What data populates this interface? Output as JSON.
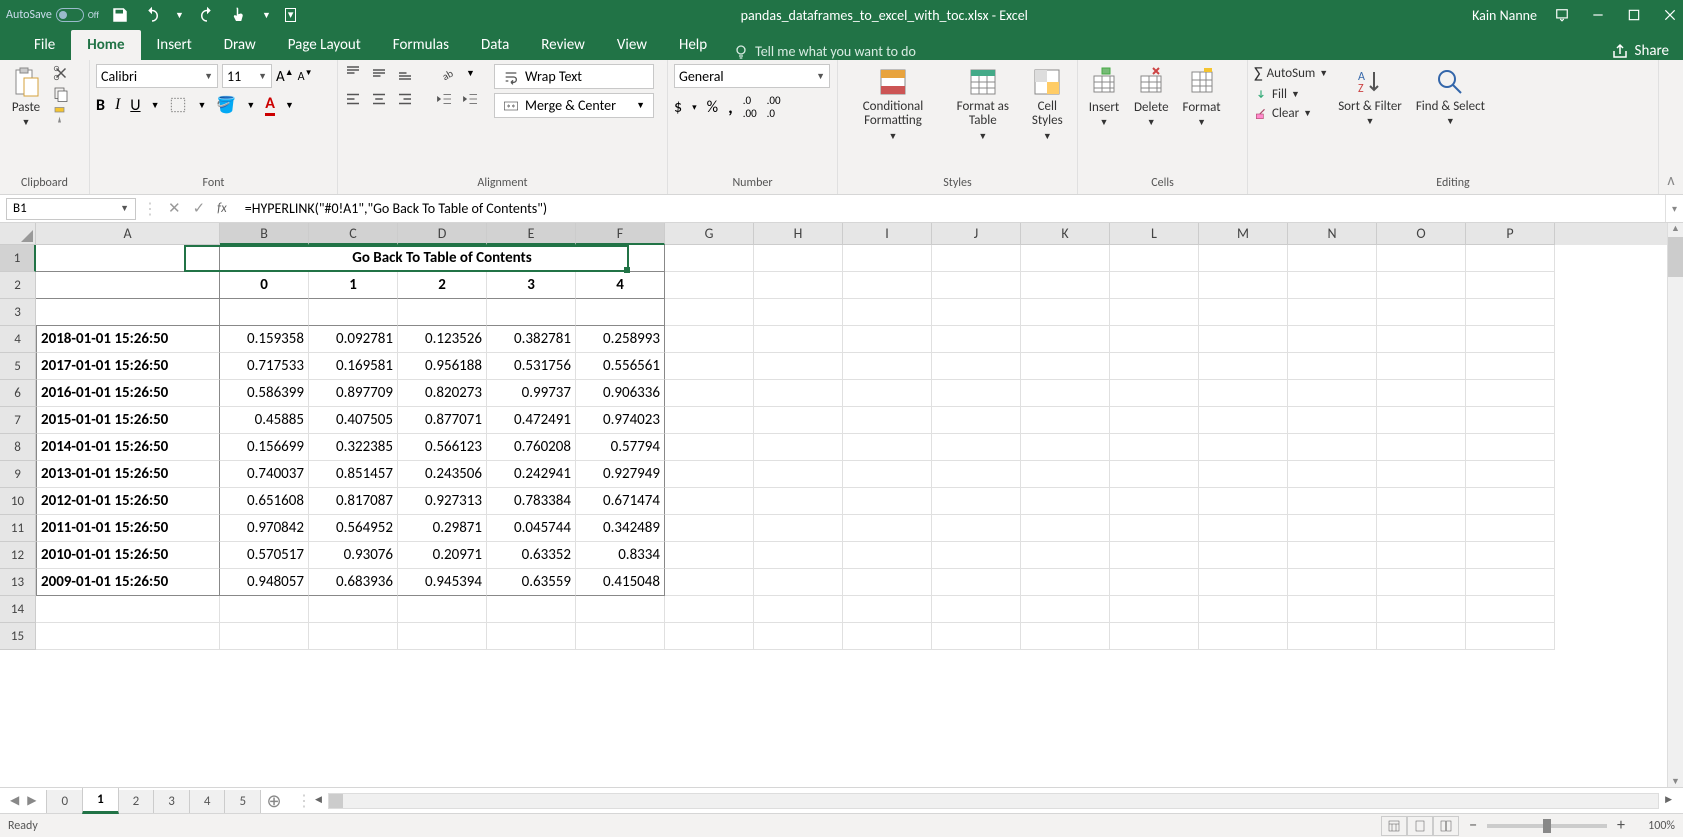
{
  "titlebar": {
    "autosave": "AutoSave",
    "autosave_state": "Off",
    "filename": "pandas_dataframes_to_excel_with_toc.xlsx - Excel",
    "user": "Kain Nanne"
  },
  "menu": {
    "tabs": [
      "File",
      "Home",
      "Insert",
      "Draw",
      "Page Layout",
      "Formulas",
      "Data",
      "Review",
      "View",
      "Help"
    ],
    "active": "Home",
    "tellme": "Tell me what you want to do",
    "share": "Share"
  },
  "ribbon": {
    "clipboard": {
      "label": "Clipboard",
      "paste": "Paste"
    },
    "font": {
      "label": "Font",
      "name": "Calibri",
      "size": "11"
    },
    "alignment": {
      "label": "Alignment",
      "wrap": "Wrap Text",
      "merge": "Merge & Center"
    },
    "number": {
      "label": "Number",
      "format": "General"
    },
    "styles": {
      "label": "Styles",
      "cond": "Conditional Formatting",
      "table": "Format as Table",
      "cell": "Cell Styles"
    },
    "cells": {
      "label": "Cells",
      "insert": "Insert",
      "delete": "Delete",
      "format": "Format"
    },
    "editing": {
      "label": "Editing",
      "autosum": "AutoSum",
      "fill": "Fill",
      "clear": "Clear",
      "sort": "Sort & Filter",
      "find": "Find & Select"
    }
  },
  "formula_bar": {
    "cell_ref": "B1",
    "formula": "=HYPERLINK(\"#0!A1\",\"Go Back To Table of Contents\")"
  },
  "grid": {
    "columns": [
      "A",
      "B",
      "C",
      "D",
      "E",
      "F",
      "G",
      "H",
      "I",
      "J",
      "K",
      "L",
      "M",
      "N",
      "O",
      "P"
    ],
    "selected_cols": [
      "B",
      "C",
      "D",
      "E",
      "F"
    ],
    "selected_row": 1,
    "row_count": 15,
    "merged_link": "Go Back To Table of Contents",
    "headers": [
      "0",
      "1",
      "2",
      "3",
      "4"
    ],
    "data": [
      {
        "ts": "2018-01-01 15:26:50",
        "v": [
          "0.159358",
          "0.092781",
          "0.123526",
          "0.382781",
          "0.258993"
        ]
      },
      {
        "ts": "2017-01-01 15:26:50",
        "v": [
          "0.717533",
          "0.169581",
          "0.956188",
          "0.531756",
          "0.556561"
        ]
      },
      {
        "ts": "2016-01-01 15:26:50",
        "v": [
          "0.586399",
          "0.897709",
          "0.820273",
          "0.99737",
          "0.906336"
        ]
      },
      {
        "ts": "2015-01-01 15:26:50",
        "v": [
          "0.45885",
          "0.407505",
          "0.877071",
          "0.472491",
          "0.974023"
        ]
      },
      {
        "ts": "2014-01-01 15:26:50",
        "v": [
          "0.156699",
          "0.322385",
          "0.566123",
          "0.760208",
          "0.57794"
        ]
      },
      {
        "ts": "2013-01-01 15:26:50",
        "v": [
          "0.740037",
          "0.851457",
          "0.243506",
          "0.242941",
          "0.927949"
        ]
      },
      {
        "ts": "2012-01-01 15:26:50",
        "v": [
          "0.651608",
          "0.817087",
          "0.927313",
          "0.783384",
          "0.671474"
        ]
      },
      {
        "ts": "2011-01-01 15:26:50",
        "v": [
          "0.970842",
          "0.564952",
          "0.29871",
          "0.045744",
          "0.342489"
        ]
      },
      {
        "ts": "2010-01-01 15:26:50",
        "v": [
          "0.570517",
          "0.93076",
          "0.20971",
          "0.63352",
          "0.8334"
        ]
      },
      {
        "ts": "2009-01-01 15:26:50",
        "v": [
          "0.948057",
          "0.683936",
          "0.945394",
          "0.63559",
          "0.415048"
        ]
      }
    ]
  },
  "sheets": {
    "tabs": [
      "0",
      "1",
      "2",
      "3",
      "4",
      "5"
    ],
    "active": "1"
  },
  "status": {
    "ready": "Ready",
    "zoom": "100%"
  }
}
